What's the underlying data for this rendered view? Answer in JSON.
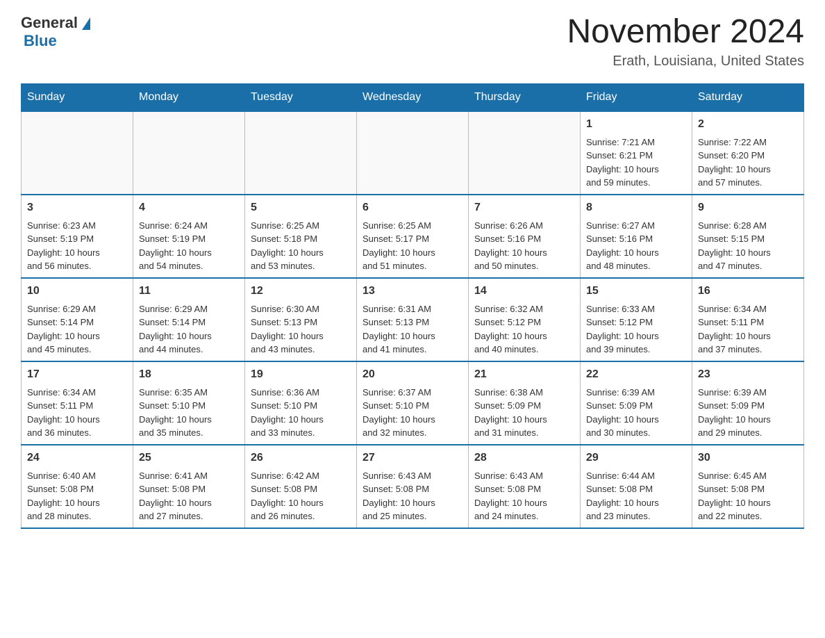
{
  "logo": {
    "general": "General",
    "blue": "Blue"
  },
  "title": "November 2024",
  "subtitle": "Erath, Louisiana, United States",
  "days_of_week": [
    "Sunday",
    "Monday",
    "Tuesday",
    "Wednesday",
    "Thursday",
    "Friday",
    "Saturday"
  ],
  "weeks": [
    [
      {
        "day": "",
        "info": ""
      },
      {
        "day": "",
        "info": ""
      },
      {
        "day": "",
        "info": ""
      },
      {
        "day": "",
        "info": ""
      },
      {
        "day": "",
        "info": ""
      },
      {
        "day": "1",
        "info": "Sunrise: 7:21 AM\nSunset: 6:21 PM\nDaylight: 10 hours\nand 59 minutes."
      },
      {
        "day": "2",
        "info": "Sunrise: 7:22 AM\nSunset: 6:20 PM\nDaylight: 10 hours\nand 57 minutes."
      }
    ],
    [
      {
        "day": "3",
        "info": "Sunrise: 6:23 AM\nSunset: 5:19 PM\nDaylight: 10 hours\nand 56 minutes."
      },
      {
        "day": "4",
        "info": "Sunrise: 6:24 AM\nSunset: 5:19 PM\nDaylight: 10 hours\nand 54 minutes."
      },
      {
        "day": "5",
        "info": "Sunrise: 6:25 AM\nSunset: 5:18 PM\nDaylight: 10 hours\nand 53 minutes."
      },
      {
        "day": "6",
        "info": "Sunrise: 6:25 AM\nSunset: 5:17 PM\nDaylight: 10 hours\nand 51 minutes."
      },
      {
        "day": "7",
        "info": "Sunrise: 6:26 AM\nSunset: 5:16 PM\nDaylight: 10 hours\nand 50 minutes."
      },
      {
        "day": "8",
        "info": "Sunrise: 6:27 AM\nSunset: 5:16 PM\nDaylight: 10 hours\nand 48 minutes."
      },
      {
        "day": "9",
        "info": "Sunrise: 6:28 AM\nSunset: 5:15 PM\nDaylight: 10 hours\nand 47 minutes."
      }
    ],
    [
      {
        "day": "10",
        "info": "Sunrise: 6:29 AM\nSunset: 5:14 PM\nDaylight: 10 hours\nand 45 minutes."
      },
      {
        "day": "11",
        "info": "Sunrise: 6:29 AM\nSunset: 5:14 PM\nDaylight: 10 hours\nand 44 minutes."
      },
      {
        "day": "12",
        "info": "Sunrise: 6:30 AM\nSunset: 5:13 PM\nDaylight: 10 hours\nand 43 minutes."
      },
      {
        "day": "13",
        "info": "Sunrise: 6:31 AM\nSunset: 5:13 PM\nDaylight: 10 hours\nand 41 minutes."
      },
      {
        "day": "14",
        "info": "Sunrise: 6:32 AM\nSunset: 5:12 PM\nDaylight: 10 hours\nand 40 minutes."
      },
      {
        "day": "15",
        "info": "Sunrise: 6:33 AM\nSunset: 5:12 PM\nDaylight: 10 hours\nand 39 minutes."
      },
      {
        "day": "16",
        "info": "Sunrise: 6:34 AM\nSunset: 5:11 PM\nDaylight: 10 hours\nand 37 minutes."
      }
    ],
    [
      {
        "day": "17",
        "info": "Sunrise: 6:34 AM\nSunset: 5:11 PM\nDaylight: 10 hours\nand 36 minutes."
      },
      {
        "day": "18",
        "info": "Sunrise: 6:35 AM\nSunset: 5:10 PM\nDaylight: 10 hours\nand 35 minutes."
      },
      {
        "day": "19",
        "info": "Sunrise: 6:36 AM\nSunset: 5:10 PM\nDaylight: 10 hours\nand 33 minutes."
      },
      {
        "day": "20",
        "info": "Sunrise: 6:37 AM\nSunset: 5:10 PM\nDaylight: 10 hours\nand 32 minutes."
      },
      {
        "day": "21",
        "info": "Sunrise: 6:38 AM\nSunset: 5:09 PM\nDaylight: 10 hours\nand 31 minutes."
      },
      {
        "day": "22",
        "info": "Sunrise: 6:39 AM\nSunset: 5:09 PM\nDaylight: 10 hours\nand 30 minutes."
      },
      {
        "day": "23",
        "info": "Sunrise: 6:39 AM\nSunset: 5:09 PM\nDaylight: 10 hours\nand 29 minutes."
      }
    ],
    [
      {
        "day": "24",
        "info": "Sunrise: 6:40 AM\nSunset: 5:08 PM\nDaylight: 10 hours\nand 28 minutes."
      },
      {
        "day": "25",
        "info": "Sunrise: 6:41 AM\nSunset: 5:08 PM\nDaylight: 10 hours\nand 27 minutes."
      },
      {
        "day": "26",
        "info": "Sunrise: 6:42 AM\nSunset: 5:08 PM\nDaylight: 10 hours\nand 26 minutes."
      },
      {
        "day": "27",
        "info": "Sunrise: 6:43 AM\nSunset: 5:08 PM\nDaylight: 10 hours\nand 25 minutes."
      },
      {
        "day": "28",
        "info": "Sunrise: 6:43 AM\nSunset: 5:08 PM\nDaylight: 10 hours\nand 24 minutes."
      },
      {
        "day": "29",
        "info": "Sunrise: 6:44 AM\nSunset: 5:08 PM\nDaylight: 10 hours\nand 23 minutes."
      },
      {
        "day": "30",
        "info": "Sunrise: 6:45 AM\nSunset: 5:08 PM\nDaylight: 10 hours\nand 22 minutes."
      }
    ]
  ]
}
